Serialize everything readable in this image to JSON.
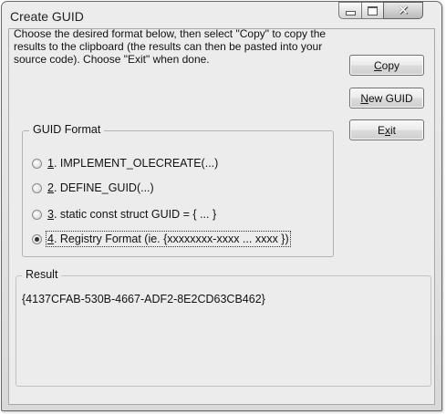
{
  "window": {
    "title": "Create GUID",
    "controls": {
      "minimize": "minimize",
      "maximize": "maximize",
      "close": "close"
    }
  },
  "instructions": "Choose the desired format below, then select \"Copy\" to copy the results to the clipboard (the results can then be pasted into your source code).  Choose \"Exit\" when done.",
  "buttons": {
    "copy": "Copy",
    "new_guid": "New GUID",
    "exit": "Exit"
  },
  "guid_format": {
    "legend": "GUID Format",
    "options": [
      {
        "number": "1",
        "label": ". IMPLEMENT_OLECREATE(...)",
        "selected": false
      },
      {
        "number": "2",
        "label": ". DEFINE_GUID(...)",
        "selected": false
      },
      {
        "number": "3",
        "label": ". static const struct GUID = { ... }",
        "selected": false
      },
      {
        "number": "4",
        "label": ". Registry Format (ie. {xxxxxxxx-xxxx ... xxxx })",
        "selected": true
      }
    ]
  },
  "result": {
    "legend": "Result",
    "value": "{4137CFAB-530B-4667-ADF2-8E2CD63CB462}"
  }
}
